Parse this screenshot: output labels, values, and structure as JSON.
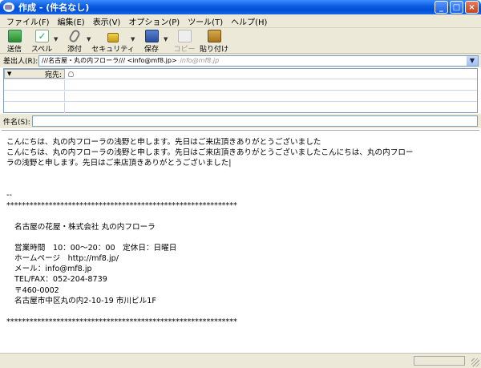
{
  "window": {
    "title": "作成 - (件名なし)"
  },
  "menu": [
    "ファイル(F)",
    "編集(E)",
    "表示(V)",
    "オプション(P)",
    "ツール(T)",
    "ヘルプ(H)"
  ],
  "toolbar": {
    "send": "送信",
    "spell": "スペル",
    "attach": "添付",
    "security": "セキュリティ",
    "save": "保存",
    "copy": "コピー",
    "paste": "貼り付け"
  },
  "from": {
    "label": "差出人(R):",
    "value": "///名古屋・丸の内フローラ/// <info@mf8.jp>",
    "hint": "info@mf8.jp"
  },
  "addressing": {
    "type_label": "宛先:"
  },
  "subject": {
    "label": "件名(S):",
    "value": ""
  },
  "body": {
    "lines": [
      "こんにちは、丸の内フローラの浅野と申します。先日はご来店頂きありがとうございました",
      "こんにちは、丸の内フローラの浅野と申します。先日はご来店頂きありがとうございましたこんにちは、丸の内フロー",
      "ラの浅野と申します。先日はご来店頂きありがとうございました|",
      "",
      "",
      "--",
      "************************************************************",
      "",
      "名古屋の花屋・株式会社 丸の内フローラ",
      "",
      "営業時間　10：00～20：00　定休日：日曜日",
      "ホームページ　http://mf8.jp/",
      "メール：info@mf8.jp",
      "TEL/FAX：052-204-8739",
      "〒460-0002",
      "名古屋市中区丸の内2-10-19 市川ビル1F",
      "",
      "************************************************************"
    ]
  },
  "icons": [
    "app-icon",
    "send-icon",
    "spell-icon",
    "attach-icon",
    "lock-icon",
    "save-icon",
    "copy-icon",
    "paste-icon",
    "person-icon"
  ]
}
